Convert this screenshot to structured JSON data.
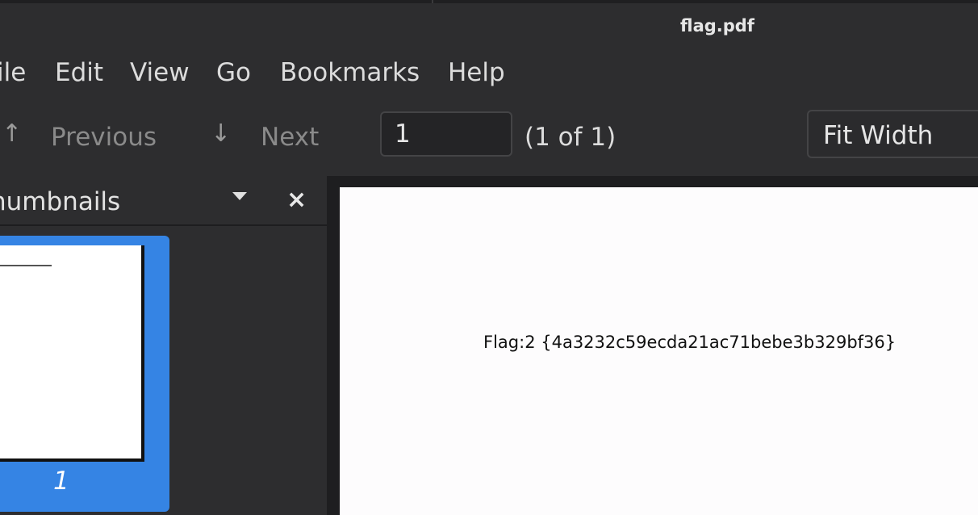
{
  "window": {
    "title": "flag.pdf"
  },
  "menu": {
    "items": [
      "ile",
      "Edit",
      "View",
      "Go",
      "Bookmarks",
      "Help"
    ]
  },
  "toolbar": {
    "previous_label": "Previous",
    "next_label": "Next",
    "page_value": "1",
    "page_count": "(1 of 1)",
    "zoom_value": "Fit Width"
  },
  "sidebar": {
    "title": "humbnails",
    "thumbnails": [
      {
        "number": "1",
        "selected": true
      }
    ]
  },
  "document": {
    "text": "Flag:2 {4a3232c59ecda21ac71bebe3b329bf36}"
  },
  "colors": {
    "background": "#2d2d2f",
    "selection": "#3584e4",
    "page": "#fdfcfd"
  },
  "icons": {
    "up_arrow": "↑",
    "down_arrow": "↓",
    "close": "×"
  }
}
